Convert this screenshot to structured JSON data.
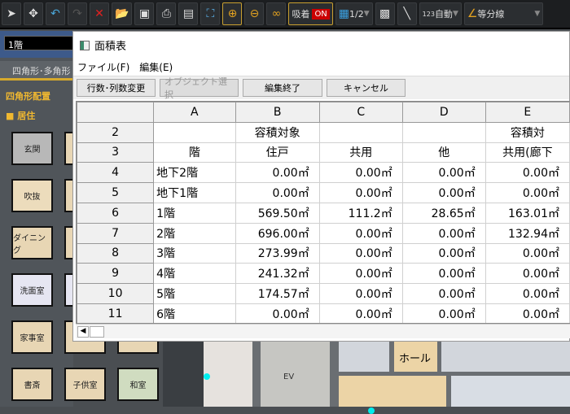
{
  "toolbar": {
    "items": [
      {
        "icon": "select-arrow-icon",
        "glyph": "➤"
      },
      {
        "icon": "multi-select-icon",
        "glyph": "✥"
      },
      {
        "icon": "undo-icon",
        "glyph": "↶"
      },
      {
        "icon": "redo-icon",
        "glyph": "↷"
      },
      {
        "icon": "delete-icon",
        "glyph": "✕"
      },
      {
        "icon": "open-folder-icon",
        "glyph": "📂"
      },
      {
        "icon": "save-icon",
        "glyph": "▣"
      },
      {
        "icon": "print-icon",
        "glyph": "⎙"
      },
      {
        "icon": "pdf-icon",
        "glyph": "▤"
      },
      {
        "icon": "fit-view-icon",
        "glyph": "⛶"
      },
      {
        "icon": "zoom-in-icon",
        "glyph": "⊕"
      },
      {
        "icon": "zoom-out-icon",
        "glyph": "⊖"
      },
      {
        "icon": "link-icon",
        "glyph": "∞"
      }
    ],
    "snap_label": "吸着",
    "snap_state": "ON",
    "grid_label": "1/2",
    "dimension_label": "自動",
    "dimension_num": "123",
    "line_label": "等分線"
  },
  "left_panel": {
    "floor": "1階",
    "tab": "四角形･多角形",
    "section": "四角形配置",
    "category": "居住",
    "tiles": [
      {
        "label": "玄関",
        "color": "#b8b8b8"
      },
      {
        "label": "吹抜",
        "color": "#ecdcbc"
      },
      {
        "label": "ダイニング",
        "color": "#e8d6b4"
      },
      {
        "label": "洗面室",
        "color": "#e6e6f2"
      },
      {
        "label": "家事室",
        "color": "#e8d6b4"
      },
      {
        "label": "書斎",
        "color": "#e8d6b4"
      },
      {
        "label": "子供室",
        "color": "#e8d6b4"
      },
      {
        "label": "和室",
        "color": "#d0dcc0"
      }
    ]
  },
  "dialog": {
    "title": "面積表",
    "menu": [
      "ファイル(F)",
      "編集(E)"
    ],
    "buttons": [
      "行数･列数変更",
      "オブジェクト選択",
      "編集終了",
      "キャンセル"
    ],
    "columns": [
      "A",
      "B",
      "C",
      "D",
      "E"
    ],
    "rows": [
      {
        "n": "2",
        "cells": [
          "",
          "容積対象",
          "",
          "",
          "容積対"
        ]
      },
      {
        "n": "3",
        "cells": [
          "階",
          "住戸",
          "共用",
          "他",
          "共用(廊下"
        ]
      },
      {
        "n": "4",
        "cells": [
          "地下2階",
          "0.00㎡",
          "0.00㎡",
          "0.00㎡",
          "0.00㎡"
        ]
      },
      {
        "n": "5",
        "cells": [
          "地下1階",
          "0.00㎡",
          "0.00㎡",
          "0.00㎡",
          "0.00㎡"
        ]
      },
      {
        "n": "6",
        "cells": [
          "1階",
          "569.50㎡",
          "111.2㎡",
          "28.65㎡",
          "163.01㎡"
        ]
      },
      {
        "n": "7",
        "cells": [
          "2階",
          "696.00㎡",
          "0.00㎡",
          "0.00㎡",
          "132.94㎡"
        ]
      },
      {
        "n": "8",
        "cells": [
          "3階",
          "273.99㎡",
          "0.00㎡",
          "0.00㎡",
          "0.00㎡"
        ]
      },
      {
        "n": "9",
        "cells": [
          "4階",
          "241.32㎡",
          "0.00㎡",
          "0.00㎡",
          "0.00㎡"
        ]
      },
      {
        "n": "10",
        "cells": [
          "5階",
          "174.57㎡",
          "0.00㎡",
          "0.00㎡",
          "0.00㎡"
        ]
      },
      {
        "n": "11",
        "cells": [
          "6階",
          "0.00㎡",
          "0.00㎡",
          "0.00㎡",
          "0.00㎡"
        ]
      }
    ]
  },
  "plan": {
    "labels": [
      "ホール",
      "EV"
    ]
  }
}
